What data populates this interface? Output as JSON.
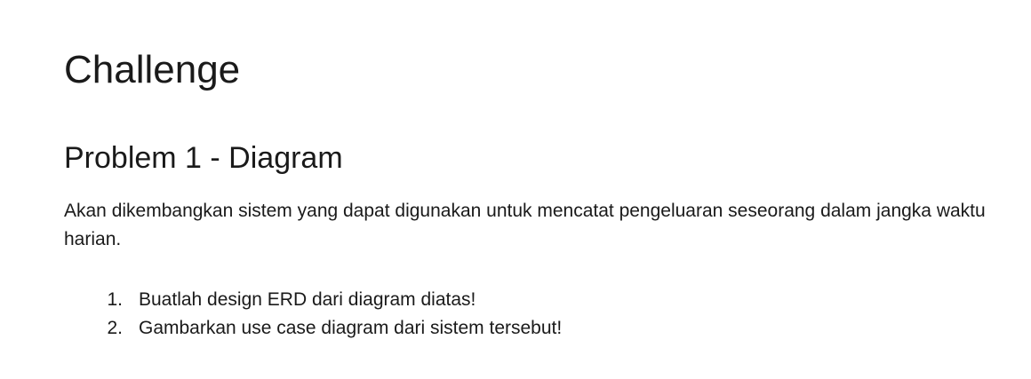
{
  "document": {
    "title": "Challenge",
    "subtitle": "Problem 1 - Diagram",
    "paragraph": "Akan dikembangkan sistem yang dapat digunakan untuk mencatat pengeluaran seseorang dalam jangka waktu harian.",
    "list": [
      {
        "num": "1.",
        "text": "Buatlah design ERD dari diagram diatas!"
      },
      {
        "num": "2.",
        "text": "Gambarkan use case diagram dari sistem tersebut!"
      }
    ]
  }
}
